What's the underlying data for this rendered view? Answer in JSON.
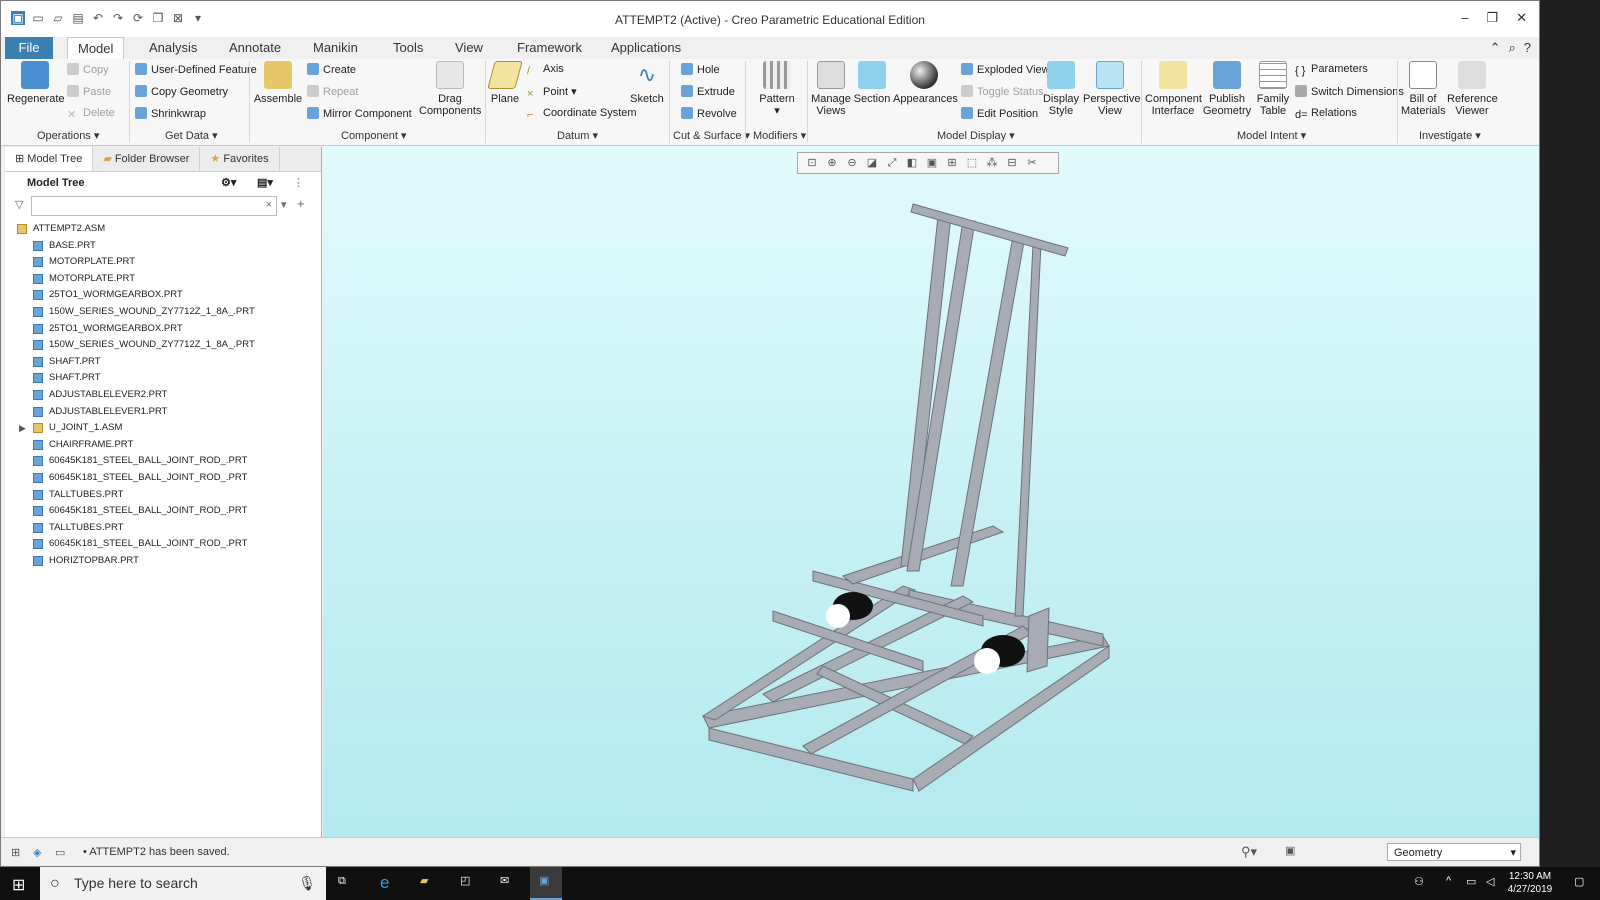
{
  "window": {
    "title": "ATTEMPT2 (Active) - Creo Parametric Educational Edition"
  },
  "menu_tabs": [
    "File",
    "Model",
    "Analysis",
    "Annotate",
    "Manikin",
    "Tools",
    "View",
    "Framework",
    "Applications"
  ],
  "ribbon": {
    "operations": {
      "regenerate": "Regenerate",
      "copy": "Copy",
      "paste": "Paste",
      "delete": "Delete",
      "group": "Operations"
    },
    "get_data": {
      "udf": "User-Defined Feature",
      "copy_geometry": "Copy Geometry",
      "shrinkwrap": "Shrinkwrap",
      "group": "Get Data"
    },
    "component": {
      "assemble": "Assemble",
      "create": "Create",
      "repeat": "Repeat",
      "mirror": "Mirror Component",
      "drag": "Drag Components",
      "group": "Component"
    },
    "datum": {
      "plane": "Plane",
      "axis": "Axis",
      "point": "Point",
      "csys": "Coordinate System",
      "sketch": "Sketch",
      "group": "Datum"
    },
    "cut_surface": {
      "hole": "Hole",
      "extrude": "Extrude",
      "revolve": "Revolve",
      "group": "Cut & Surface"
    },
    "modifiers": {
      "pattern": "Pattern",
      "group": "Modifiers"
    },
    "model_display": {
      "manage_views": "Manage Views",
      "section": "Section",
      "appearances": "Appearances",
      "exploded": "Exploded View",
      "toggle": "Toggle Status",
      "edit_pos": "Edit Position",
      "display_style": "Display Style",
      "perspective": "Perspective View",
      "group": "Model Display"
    },
    "model_intent": {
      "component_interface": "Component Interface",
      "publish_geometry": "Publish Geometry",
      "family_table": "Family Table",
      "parameters": "Parameters",
      "switch_dims": "Switch Dimensions",
      "relations": "Relations",
      "group": "Model Intent"
    },
    "investigate": {
      "bom": "Bill of Materials",
      "ref_viewer": "Reference Viewer",
      "group": "Investigate"
    }
  },
  "panel": {
    "tabs": [
      "Model Tree",
      "Folder Browser",
      "Favorites"
    ],
    "header": "Model Tree",
    "tree": [
      {
        "label": "ATTEMPT2.ASM",
        "type": "asm"
      },
      {
        "label": "BASE.PRT"
      },
      {
        "label": "MOTORPLATE.PRT"
      },
      {
        "label": "MOTORPLATE.PRT"
      },
      {
        "label": "25TO1_WORMGEARBOX.PRT"
      },
      {
        "label": "150W_SERIES_WOUND_ZY7712Z_1_8A_.PRT"
      },
      {
        "label": "25TO1_WORMGEARBOX.PRT"
      },
      {
        "label": "150W_SERIES_WOUND_ZY7712Z_1_8A_.PRT"
      },
      {
        "label": "SHAFT.PRT"
      },
      {
        "label": "SHAFT.PRT"
      },
      {
        "label": "ADJUSTABLELEVER2.PRT"
      },
      {
        "label": "ADJUSTABLELEVER1.PRT"
      },
      {
        "label": "U_JOINT_1.ASM",
        "type": "asm"
      },
      {
        "label": "CHAIRFRAME.PRT"
      },
      {
        "label": "60645K181_STEEL_BALL_JOINT_ROD_.PRT"
      },
      {
        "label": "60645K181_STEEL_BALL_JOINT_ROD_.PRT"
      },
      {
        "label": "TALLTUBES.PRT"
      },
      {
        "label": "60645K181_STEEL_BALL_JOINT_ROD_.PRT"
      },
      {
        "label": "TALLTUBES.PRT"
      },
      {
        "label": "60645K181_STEEL_BALL_JOINT_ROD_.PRT"
      },
      {
        "label": "HORIZTOPBAR.PRT"
      }
    ]
  },
  "status": {
    "message": "ATTEMPT2 has been saved.",
    "filter": "Geometry"
  },
  "taskbar": {
    "search_placeholder": "Type here to search",
    "time": "12:30 AM",
    "date": "4/27/2019"
  }
}
